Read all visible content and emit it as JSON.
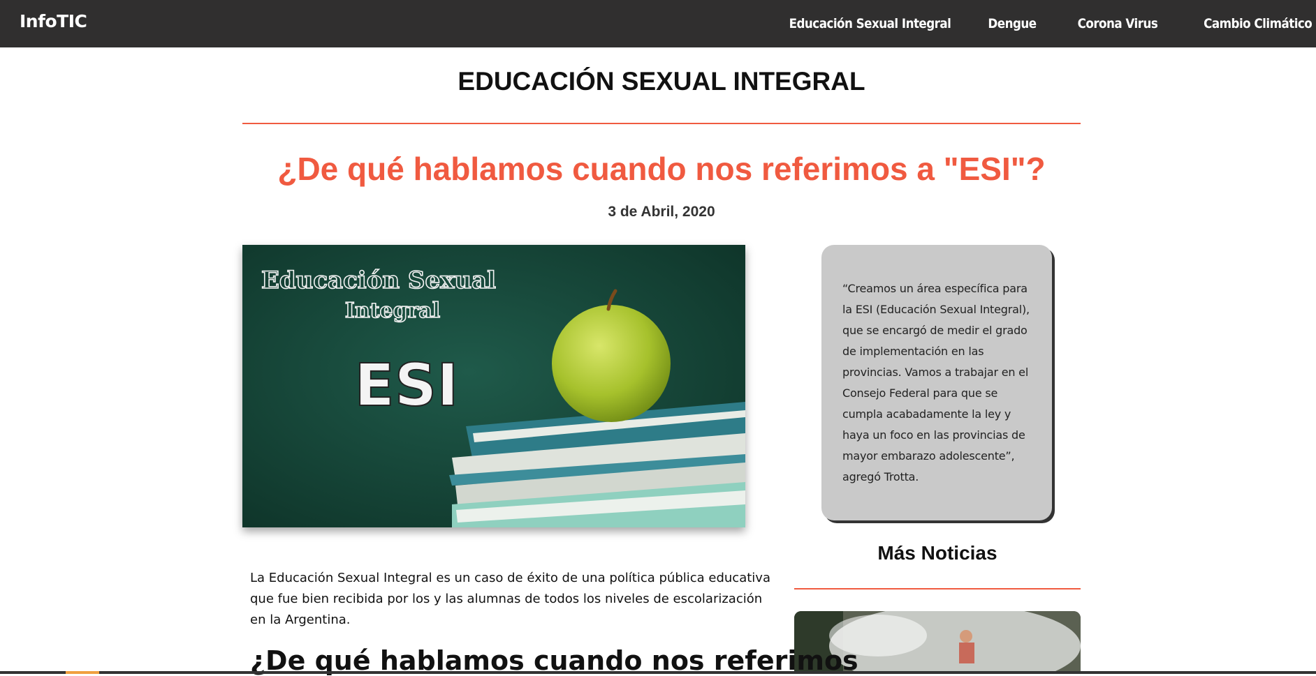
{
  "navbar": {
    "brand": "InfoTIC",
    "links": [
      {
        "label": "Educación Sexual Integral"
      },
      {
        "label": "Dengue"
      },
      {
        "label": "Corona Virus"
      },
      {
        "label": "Cambio Climático"
      }
    ]
  },
  "section": {
    "title": "EDUCACIÓN SEXUAL INTEGRAL"
  },
  "article": {
    "title": "¿De qué hablamos cuando nos referimos a \"ESI\"?",
    "date": "3 de Abril, 2020",
    "hero_image": {
      "line1": "Educación Sexual",
      "line2": "Integral",
      "big": "ESI"
    },
    "paragraph": "La Educación Sexual Integral es un caso de éxito de una política pública educativa que fue bien recibida por los y las alumnas de todos los niveles de escolarización en la Argentina.",
    "subheading": "¿De qué hablamos cuando nos referimos"
  },
  "sidebar": {
    "quote": "“Creamos un área específica para la ESI (Educación Sexual Integral), que se encargó de medir el grado de implementación en las provincias. Vamos a trabajar en el Consejo Federal para que se cumpla acabadamente la ley y haya un foco en las provincias de mayor embarazo adolescente”, agregó Trotta.",
    "more_news_title": "Más Noticias"
  },
  "colors": {
    "accent": "#f05a40",
    "navbar": "#302f2f",
    "quote_bg": "#c9c9c9"
  }
}
